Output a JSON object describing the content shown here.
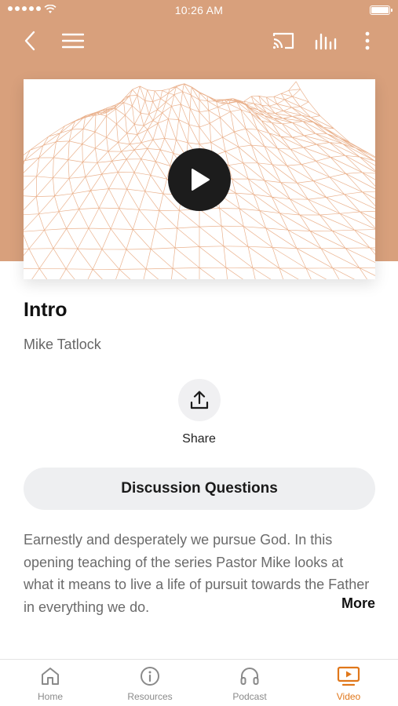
{
  "status_bar": {
    "time": "10:26 AM"
  },
  "video": {
    "title": "Intro",
    "author": "Mike Tatlock"
  },
  "actions": {
    "share_label": "Share"
  },
  "discussion": {
    "label": "Discussion Questions"
  },
  "description": {
    "text": "Earnestly and desperately we pursue God. In this opening teaching of the series Pastor Mike looks at what it means to live a life of pursuit towards the Father in everything we do.",
    "more_label": "More"
  },
  "tabs": [
    {
      "label": "Home",
      "icon": "home-icon",
      "active": false
    },
    {
      "label": "Resources",
      "icon": "info-icon",
      "active": false
    },
    {
      "label": "Podcast",
      "icon": "headphones-icon",
      "active": false
    },
    {
      "label": "Video",
      "icon": "video-icon",
      "active": true
    }
  ],
  "colors": {
    "header": "#d8a07c",
    "accent": "#e0771a",
    "wireframe": "#e6a57a"
  }
}
